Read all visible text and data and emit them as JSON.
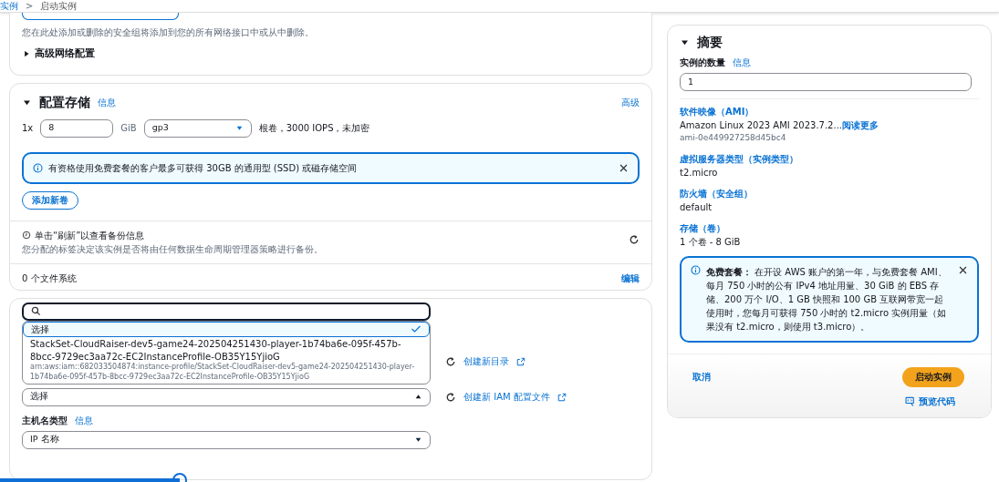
{
  "breadcrumb": {
    "parent": "实例",
    "separator": ">",
    "current": "启动实例"
  },
  "network": {
    "hint": "您在此处添加或删除的安全组将添加到您的所有网络接口中或从中删除。",
    "advanced": {
      "label": "高级网络配置",
      "expanded": false
    }
  },
  "storage": {
    "title": "配置存储",
    "expanded": true,
    "info": "信息",
    "advanced": "高级",
    "count": "1x",
    "size": "8",
    "unit": "GiB",
    "volume_type": "gp3",
    "volume_desc": "根卷，3000 IOPS，未加密",
    "alert": "有资格使用免费套餐的客户最多可获得 30GB 的通用型 (SSD) 或磁存储空间",
    "add_button": "添加新卷",
    "backup_title": "单击“刷新”以查看备份信息",
    "backup_desc": "您分配的标签决定该实例是否将由任何数据生命周期管理器策略进行备份。",
    "filesystems": "0 个文件系统",
    "edit": "编辑"
  },
  "details": {
    "dropdown_options": [
      {
        "label": "选择",
        "selected": true
      },
      {
        "label": "StackSet-CloudRaiser-dev5-game24-202504251430-player-1b74ba6e-095f-457b-8bcc-9729ec3aa72c-EC2InstanceProfile-OB35Y15YjioG",
        "detail": "arn:aws:iam::682033504874:instance-profile/StackSet-CloudRaiser-dev5-game24-202504251430-player-1b74ba6e-095f-457b-8bcc-9729ec3aa72c-EC2InstanceProfile-OB35Y15YjioG",
        "selected": false
      }
    ],
    "create_directory": "创建新目录",
    "profile_select": "选择",
    "create_profile": "创建新 IAM 配置文件",
    "hostname_label": "主机名类型",
    "hostname_info": "信息",
    "hostname_value": "IP 名称"
  },
  "summary": {
    "title": "摘要",
    "expanded": true,
    "count_label": "实例的数量",
    "count_info": "信息",
    "count_value": "1",
    "items": [
      {
        "label": "软件映像（AMI）",
        "value": "Amazon Linux 2023 AMI 2023.7.2...",
        "link": "阅读更多",
        "sub": "ami-0e449927258d45bc4"
      },
      {
        "label": "虚拟服务器类型（实例类型）",
        "value": "t2.micro"
      },
      {
        "label": "防火墙（安全组）",
        "value": "default"
      },
      {
        "label": "存储（卷）",
        "value": "1 个卷 - 8 GiB"
      }
    ],
    "free_tier": "**免费套餐：** 在开设 AWS 账户的第一年，与免费套餐 AMI、每月 750 小时的公有 IPv4 地址用量、30 GiB 的 EBS 存储、200 万个 I/O、1 GB 快照和 100 GB 互联网带宽一起使用时，您每月可获得 750 小时的 t2.micro 实例用量（如果没有 t2.micro，则使用 t3.micro）。",
    "cancel": "取消",
    "launch": "启动实例",
    "preview": "预览代码"
  },
  "video_progress": {
    "level": 0.18
  }
}
